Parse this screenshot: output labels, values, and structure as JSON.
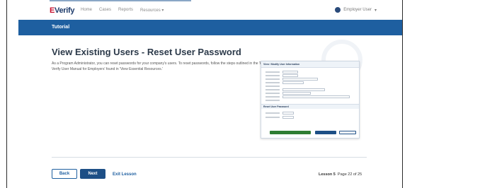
{
  "nav": {
    "logo_e": "E",
    "logo_rest": "Verify",
    "links": [
      "Home",
      "Cases",
      "Reports",
      "Resources"
    ],
    "resources_caret": "▾",
    "user": "Employer User",
    "user_caret": "▾"
  },
  "tutorial_bar": {
    "label": "Tutorial"
  },
  "main": {
    "title": "View Existing Users - Reset User Password",
    "description": "As a Program Administrator, you can reset passwords for your company's users. To reset passwords, follow the steps outlined in the 'E-Verify User Manual for Employers' found in 'View Essential Resources.'"
  },
  "shot": {
    "header": "View / Modify User Information",
    "reset_section": "Reset User Password"
  },
  "footer": {
    "back": "Back",
    "next": "Next",
    "exit": "Exit Lesson",
    "lesson_label": "Lesson 5",
    "page": "Page 22 of 25"
  },
  "colors": {
    "brand_blue": "#1e5fa0",
    "dark_blue": "#1d4f86",
    "logo_red": "#c8102e"
  }
}
